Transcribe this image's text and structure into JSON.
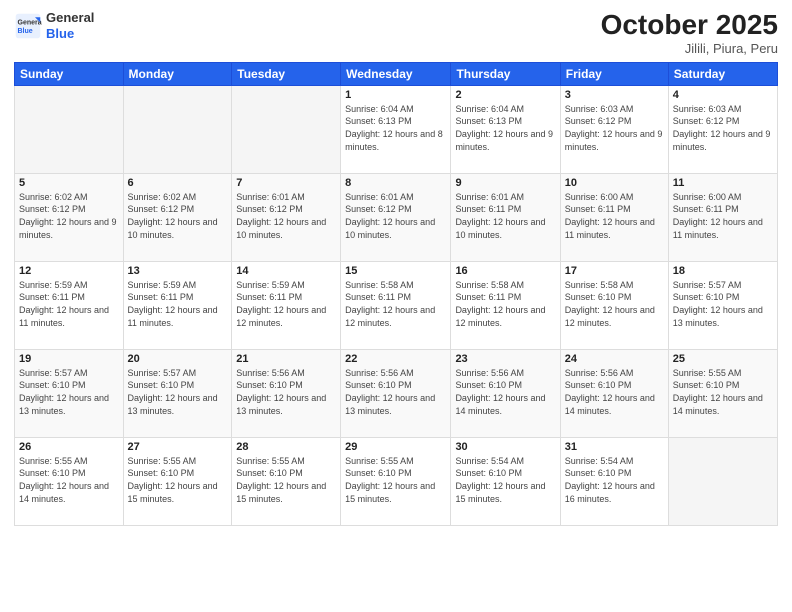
{
  "header": {
    "logo_line1": "General",
    "logo_line2": "Blue",
    "month": "October 2025",
    "location": "Jilili, Piura, Peru"
  },
  "days_of_week": [
    "Sunday",
    "Monday",
    "Tuesday",
    "Wednesday",
    "Thursday",
    "Friday",
    "Saturday"
  ],
  "weeks": [
    [
      {
        "day": "",
        "info": ""
      },
      {
        "day": "",
        "info": ""
      },
      {
        "day": "",
        "info": ""
      },
      {
        "day": "1",
        "info": "Sunrise: 6:04 AM\nSunset: 6:13 PM\nDaylight: 12 hours and 8 minutes."
      },
      {
        "day": "2",
        "info": "Sunrise: 6:04 AM\nSunset: 6:13 PM\nDaylight: 12 hours and 9 minutes."
      },
      {
        "day": "3",
        "info": "Sunrise: 6:03 AM\nSunset: 6:12 PM\nDaylight: 12 hours and 9 minutes."
      },
      {
        "day": "4",
        "info": "Sunrise: 6:03 AM\nSunset: 6:12 PM\nDaylight: 12 hours and 9 minutes."
      }
    ],
    [
      {
        "day": "5",
        "info": "Sunrise: 6:02 AM\nSunset: 6:12 PM\nDaylight: 12 hours and 9 minutes."
      },
      {
        "day": "6",
        "info": "Sunrise: 6:02 AM\nSunset: 6:12 PM\nDaylight: 12 hours and 10 minutes."
      },
      {
        "day": "7",
        "info": "Sunrise: 6:01 AM\nSunset: 6:12 PM\nDaylight: 12 hours and 10 minutes."
      },
      {
        "day": "8",
        "info": "Sunrise: 6:01 AM\nSunset: 6:12 PM\nDaylight: 12 hours and 10 minutes."
      },
      {
        "day": "9",
        "info": "Sunrise: 6:01 AM\nSunset: 6:11 PM\nDaylight: 12 hours and 10 minutes."
      },
      {
        "day": "10",
        "info": "Sunrise: 6:00 AM\nSunset: 6:11 PM\nDaylight: 12 hours and 11 minutes."
      },
      {
        "day": "11",
        "info": "Sunrise: 6:00 AM\nSunset: 6:11 PM\nDaylight: 12 hours and 11 minutes."
      }
    ],
    [
      {
        "day": "12",
        "info": "Sunrise: 5:59 AM\nSunset: 6:11 PM\nDaylight: 12 hours and 11 minutes."
      },
      {
        "day": "13",
        "info": "Sunrise: 5:59 AM\nSunset: 6:11 PM\nDaylight: 12 hours and 11 minutes."
      },
      {
        "day": "14",
        "info": "Sunrise: 5:59 AM\nSunset: 6:11 PM\nDaylight: 12 hours and 12 minutes."
      },
      {
        "day": "15",
        "info": "Sunrise: 5:58 AM\nSunset: 6:11 PM\nDaylight: 12 hours and 12 minutes."
      },
      {
        "day": "16",
        "info": "Sunrise: 5:58 AM\nSunset: 6:11 PM\nDaylight: 12 hours and 12 minutes."
      },
      {
        "day": "17",
        "info": "Sunrise: 5:58 AM\nSunset: 6:10 PM\nDaylight: 12 hours and 12 minutes."
      },
      {
        "day": "18",
        "info": "Sunrise: 5:57 AM\nSunset: 6:10 PM\nDaylight: 12 hours and 13 minutes."
      }
    ],
    [
      {
        "day": "19",
        "info": "Sunrise: 5:57 AM\nSunset: 6:10 PM\nDaylight: 12 hours and 13 minutes."
      },
      {
        "day": "20",
        "info": "Sunrise: 5:57 AM\nSunset: 6:10 PM\nDaylight: 12 hours and 13 minutes."
      },
      {
        "day": "21",
        "info": "Sunrise: 5:56 AM\nSunset: 6:10 PM\nDaylight: 12 hours and 13 minutes."
      },
      {
        "day": "22",
        "info": "Sunrise: 5:56 AM\nSunset: 6:10 PM\nDaylight: 12 hours and 13 minutes."
      },
      {
        "day": "23",
        "info": "Sunrise: 5:56 AM\nSunset: 6:10 PM\nDaylight: 12 hours and 14 minutes."
      },
      {
        "day": "24",
        "info": "Sunrise: 5:56 AM\nSunset: 6:10 PM\nDaylight: 12 hours and 14 minutes."
      },
      {
        "day": "25",
        "info": "Sunrise: 5:55 AM\nSunset: 6:10 PM\nDaylight: 12 hours and 14 minutes."
      }
    ],
    [
      {
        "day": "26",
        "info": "Sunrise: 5:55 AM\nSunset: 6:10 PM\nDaylight: 12 hours and 14 minutes."
      },
      {
        "day": "27",
        "info": "Sunrise: 5:55 AM\nSunset: 6:10 PM\nDaylight: 12 hours and 15 minutes."
      },
      {
        "day": "28",
        "info": "Sunrise: 5:55 AM\nSunset: 6:10 PM\nDaylight: 12 hours and 15 minutes."
      },
      {
        "day": "29",
        "info": "Sunrise: 5:55 AM\nSunset: 6:10 PM\nDaylight: 12 hours and 15 minutes."
      },
      {
        "day": "30",
        "info": "Sunrise: 5:54 AM\nSunset: 6:10 PM\nDaylight: 12 hours and 15 minutes."
      },
      {
        "day": "31",
        "info": "Sunrise: 5:54 AM\nSunset: 6:10 PM\nDaylight: 12 hours and 16 minutes."
      },
      {
        "day": "",
        "info": ""
      }
    ]
  ]
}
